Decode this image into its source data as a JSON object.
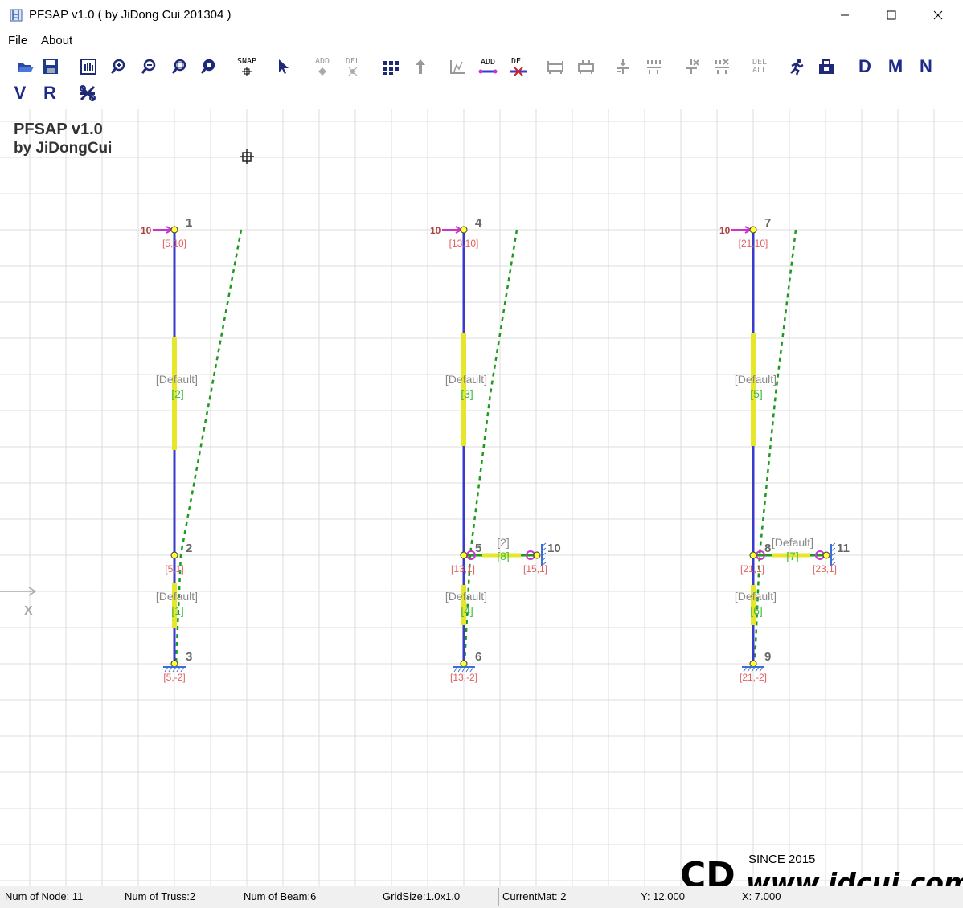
{
  "window": {
    "title": "PFSAP v1.0 ( by JiDong Cui 201304 )"
  },
  "menu": {
    "items": [
      "File",
      "About"
    ]
  },
  "toolbar": {
    "snap_label": "SNAP",
    "add_label": "ADD",
    "del_label": "DEL",
    "del_all_top": "DEL",
    "del_all_bottom": "ALL",
    "d_label": "D",
    "m_label": "M",
    "n_label": "N",
    "v_label": "V",
    "r_label": "R"
  },
  "canvas": {
    "watermark_title": "PFSAP v1.0",
    "watermark_author": "by JiDongCui",
    "axis_label": "X",
    "colors": {
      "grid": "#dcdcdc",
      "member": "#3a3acc",
      "section": "#e6e62a",
      "deform": "#1e9a1e",
      "load": "#cc33cc",
      "coord": "#e06060",
      "node_label": "#666666",
      "section_label": "#888888",
      "elem_label": "#44bb44"
    },
    "frames": [
      {
        "top_node": "1",
        "mid_node": "2",
        "base_node": "3",
        "load_value": "10",
        "top_coord": "[5,10]",
        "mid_coord": "[5,1]",
        "base_coord": "[5,-2]",
        "upper_section": "[Default]",
        "upper_elem": "[2]",
        "lower_section": "[Default]",
        "lower_elem": "[1]"
      },
      {
        "top_node": "4",
        "mid_node": "5",
        "base_node": "6",
        "beam_end_node": "10",
        "load_value": "10",
        "top_coord": "[13,10]",
        "mid_coord": "[13,1]",
        "base_coord": "[13,-2]",
        "beam_end_coord": "[15,1]",
        "upper_section": "[Default]",
        "upper_elem": "[3]",
        "lower_section": "[Default]",
        "lower_elem": "[4]",
        "beam_section": "[2]",
        "beam_elem": "[8]"
      },
      {
        "top_node": "7",
        "mid_node": "8",
        "base_node": "9",
        "beam_end_node": "11",
        "load_value": "10",
        "top_coord": "[21,10]",
        "mid_coord": "[21,1]",
        "base_coord": "[21,-2]",
        "beam_end_coord": "[23,1]",
        "upper_section": "[Default]",
        "upper_elem": "[5]",
        "lower_section": "[Default]",
        "lower_elem": "[6]",
        "beam_section": "[Default]",
        "beam_elem": "[7]"
      }
    ],
    "logo": {
      "since": "SINCE 2015",
      "site": "www.jdcui.com",
      "mark": "CD"
    }
  },
  "status": {
    "num_node": "Num of Node: 11",
    "num_truss": "Num of Truss:2",
    "num_beam": "Num of Beam:6",
    "grid_size": "GridSize:1.0x1.0",
    "current_mat": "CurrentMat: 2",
    "y": "Y: 12.000",
    "x": "X: 7.000"
  }
}
